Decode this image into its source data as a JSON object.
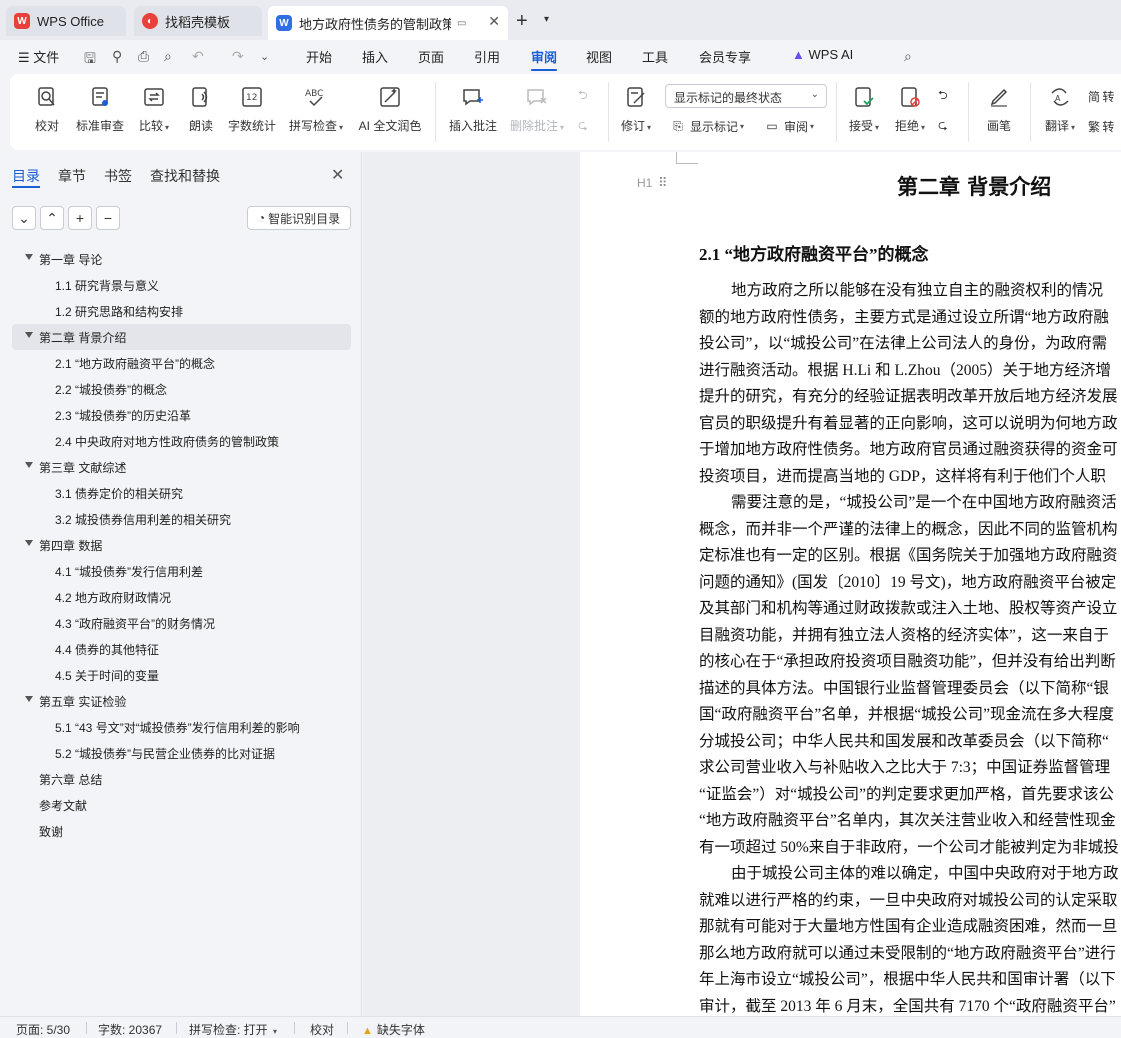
{
  "tabs": {
    "wps": "WPS Office",
    "templates": "找稻壳模板",
    "document": "地方政府性债务的管制政策与",
    "document_extra": "▭"
  },
  "menu": {
    "file": "文件",
    "items": [
      "开始",
      "插入",
      "页面",
      "引用",
      "审阅",
      "视图",
      "工具",
      "会员专享"
    ],
    "active": "审阅",
    "ai": "WPS AI"
  },
  "ribbon": {
    "proofread": "校对",
    "standard_review": "标准审查",
    "compare": "比较",
    "read_aloud": "朗读",
    "word_count": "字数统计",
    "spell_check": "拼写检查",
    "ai_polish": "AI 全文润色",
    "insert_comment": "插入批注",
    "delete_comment": "删除批注",
    "track_changes": "修订",
    "markup_mode": "显示标记的最终状态",
    "show_markup": "显示标记",
    "review_pane": "审阅",
    "accept": "接受",
    "reject": "拒绝",
    "pen": "画笔",
    "translate": "翻译",
    "trad_simp_1": "简 转",
    "trad_simp_2": "繁 转"
  },
  "nav": {
    "tabs": [
      "目录",
      "章节",
      "书签",
      "查找和替换"
    ],
    "smart_toc": "智能识别目录",
    "toc": [
      {
        "text": "第一章  导论",
        "level": 1,
        "expanded": true
      },
      {
        "text": "1.1  研究背景与意义",
        "level": 2
      },
      {
        "text": "1.2  研究思路和结构安排",
        "level": 2
      },
      {
        "text": "第二章  背景介绍",
        "level": 1,
        "expanded": true,
        "selected": true
      },
      {
        "text": "2.1 “地方政府融资平台”的概念",
        "level": 2
      },
      {
        "text": "2.2 “城投债券”的概念",
        "level": 2
      },
      {
        "text": "2.3 “城投债券”的历史沿革",
        "level": 2
      },
      {
        "text": "2.4 中央政府对地方性政府债务的管制政策",
        "level": 2
      },
      {
        "text": "第三章  文献综述",
        "level": 1,
        "expanded": true
      },
      {
        "text": "3.1  债券定价的相关研究",
        "level": 2
      },
      {
        "text": "3.2  城投债券信用利差的相关研究",
        "level": 2
      },
      {
        "text": "第四章  数据",
        "level": 1,
        "expanded": true
      },
      {
        "text": "4.1 “城投债券”发行信用利差",
        "level": 2
      },
      {
        "text": "4.2 地方政府财政情况",
        "level": 2
      },
      {
        "text": "4.3 “政府融资平台”的财务情况",
        "level": 2
      },
      {
        "text": "4.4 债券的其他特征",
        "level": 2
      },
      {
        "text": "4.5 关于时间的变量",
        "level": 2
      },
      {
        "text": "第五章  实证检验",
        "level": 1,
        "expanded": true
      },
      {
        "text": "5.1 “43 号文”对“城投债券”发行信用利差的影响",
        "level": 2
      },
      {
        "text": "5.2 “城投债券”与民营企业债券的比对证据",
        "level": 2
      },
      {
        "text": "第六章  总结",
        "level": 1
      },
      {
        "text": "参考文献",
        "level": 1
      },
      {
        "text": "致谢",
        "level": 1
      }
    ]
  },
  "document": {
    "heading_marker": "H1",
    "chapter_title": "第二章  背景介绍",
    "section_title": "2.1 “地方政府融资平台”的概念",
    "lines": [
      {
        "text": "地方政府之所以能够在没有独立自主的融资权利的情况",
        "indent": true
      },
      {
        "text": "额的地方政府性债务，主要方式是通过设立所谓“地方政府融",
        "indent": false
      },
      {
        "text": "投公司”，以“城投公司”在法律上公司法人的身份，为政府需",
        "indent": false
      },
      {
        "text": "进行融资活动。根据 H.Li 和  L.Zhou（2005）关于地方经济增",
        "indent": false
      },
      {
        "text": "提升的研究，有充分的经验证据表明改革开放后地方经济发展",
        "indent": false
      },
      {
        "text": "官员的职级提升有着显著的正向影响，这可以说明为何地方政",
        "indent": false
      },
      {
        "text": "于增加地方政府性债务。地方政府官员通过融资获得的资金可",
        "indent": false
      },
      {
        "text": "投资项目，进而提高当地的 GDP，这样将有利于他们个人职",
        "indent": false
      },
      {
        "text": "需要注意的是，“城投公司”是一个在中国地方政府融资活",
        "indent": true
      },
      {
        "text": "概念，而并非一个严谨的法律上的概念，因此不同的监管机构",
        "indent": false
      },
      {
        "text": "定标准也有一定的区别。根据《国务院关于加强地方政府融资",
        "indent": false
      },
      {
        "text": "问题的通知》(国发〔2010〕19 号文)，地方政府融资平台被定",
        "indent": false
      },
      {
        "text": "及其部门和机构等通过财政拨款或注入土地、股权等资产设立",
        "indent": false
      },
      {
        "text": "目融资功能，并拥有独立法人资格的经济实体”，这一来自于",
        "indent": false
      },
      {
        "text": "的核心在于“承担政府投资项目融资功能”，但并没有给出判断",
        "indent": false
      },
      {
        "text": "描述的具体方法。中国银行业监督管理委员会（以下简称“银",
        "indent": false
      },
      {
        "text": "国“政府融资平台”名单，并根据“城投公司”现金流在多大程度",
        "indent": false
      },
      {
        "text": "分城投公司；中华人民共和国发展和改革委员会（以下简称“",
        "indent": false
      },
      {
        "text": "求公司营业收入与补贴收入之比大于 7:3；中国证券监督管理",
        "indent": false
      },
      {
        "text": "“证监会”）对“城投公司”的判定要求更加严格，首先要求该公",
        "indent": false
      },
      {
        "text": "“地方政府融资平台”名单内，其次关注营业收入和经营性现金",
        "indent": false
      },
      {
        "text": "有一项超过 50%来自于非政府，一个公司才能被判定为非城投",
        "indent": false
      },
      {
        "text": "由于城投公司主体的难以确定，中国中央政府对于地方政",
        "indent": true
      },
      {
        "text": "就难以进行严格的约束，一旦中央政府对城投公司的认定采取",
        "indent": false
      },
      {
        "text": "那就有可能对于大量地方性国有企业造成融资困难，然而一旦",
        "indent": false
      },
      {
        "text": "那么地方政府就可以通过未受限制的“地方政府融资平台”进行",
        "indent": false
      },
      {
        "text": "年上海市设立“城投公司”，根据中华人民共和国审计署（以下",
        "indent": false
      },
      {
        "text": "审计，截至 2013 年 6 月末，全国共有 7170 个“政府融资平台”",
        "indent": false
      }
    ]
  },
  "status": {
    "page": "页面: 5/30",
    "word_count": "字数: 20367",
    "spell_check": "拼写检查: 打开",
    "proofread": "校对",
    "missing_font": "缺失字体"
  }
}
